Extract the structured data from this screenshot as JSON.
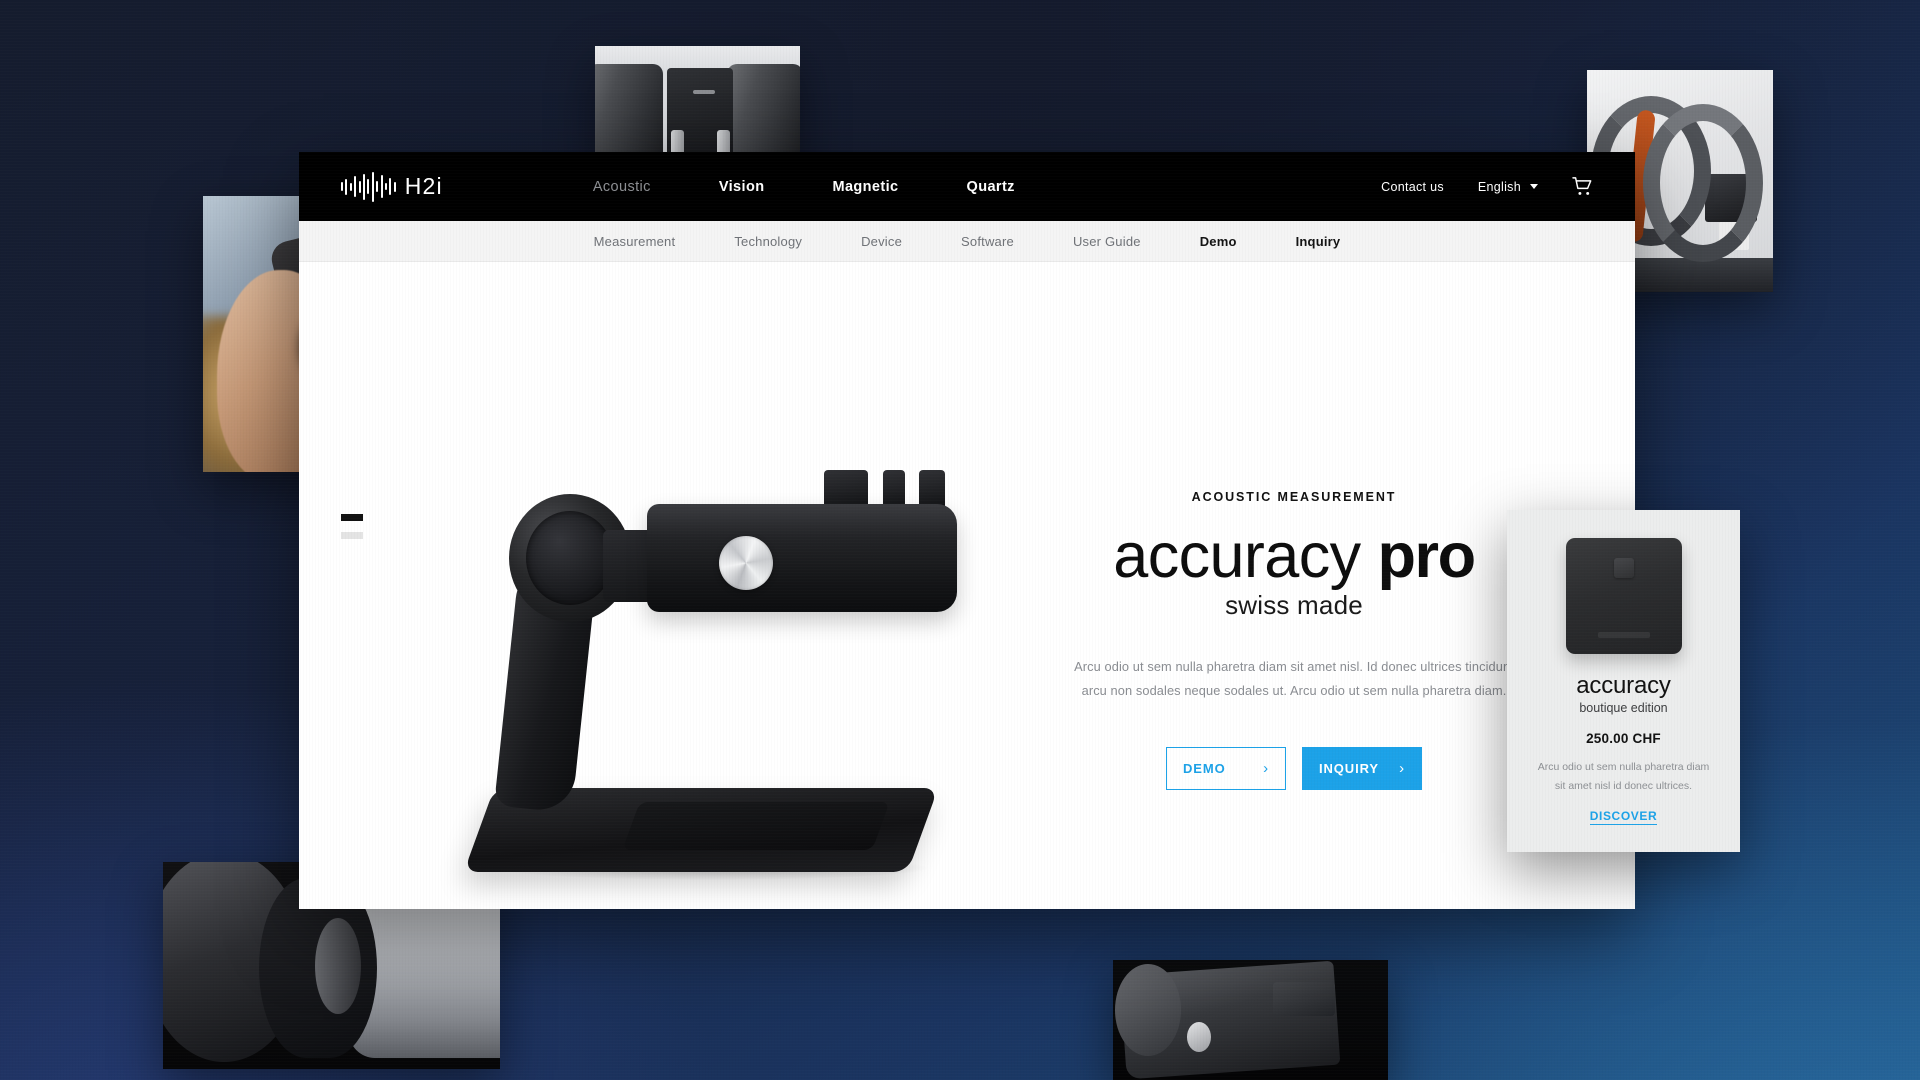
{
  "site": {
    "logo": {
      "text": "H2i",
      "icon": "waveform-icon"
    },
    "main_nav": [
      {
        "label": "Acoustic",
        "state": "muted"
      },
      {
        "label": "Vision",
        "state": "active"
      },
      {
        "label": "Magnetic",
        "state": "active"
      },
      {
        "label": "Quartz",
        "state": "active"
      }
    ],
    "nav_right": {
      "contact_label": "Contact us",
      "language": "English",
      "language_caret_icon": "chevron-down-icon",
      "cart_icon": "shopping-cart-icon"
    },
    "sub_nav": [
      {
        "label": "Measurement",
        "active": false
      },
      {
        "label": "Technology",
        "active": false
      },
      {
        "label": "Device",
        "active": false
      },
      {
        "label": "Software",
        "active": false
      },
      {
        "label": "User Guide",
        "active": false
      },
      {
        "label": "Demo",
        "active": true
      },
      {
        "label": "Inquiry",
        "active": true
      }
    ]
  },
  "hero": {
    "eyebrow": "ACOUSTIC MEASUREMENT",
    "headline_light": "accuracy ",
    "headline_bold": "pro",
    "subhead": "swiss made",
    "blurb_line1": "Arcu odio ut sem nulla pharetra diam sit amet nisl. Id donec ultrices tincidunt",
    "blurb_line2": "arcu non sodales neque sodales ut. Arcu odio ut sem nulla pharetra diam.",
    "cta_demo": "DEMO",
    "cta_inquiry": "INQUIRY",
    "chevron": "›",
    "product_image_alt": "accuracy-pro-device-on-stand"
  },
  "product_card": {
    "device_image_alt": "accuracy-boutique-device",
    "title": "accuracy",
    "subtitle": "boutique edition",
    "price": "250.00 CHF",
    "desc_line1": "Arcu odio ut sem nulla pharetra diam",
    "desc_line2": "sit amet nisl id donec ultrices.",
    "link_label": "DISCOVER"
  },
  "decor_images": [
    {
      "name": "top-center-mechanism-photo"
    },
    {
      "name": "top-right-helmholtz-coil-photo"
    },
    {
      "name": "left-wristwatch-in-hands-photo"
    },
    {
      "name": "bottom-left-metal-cylinder-photo"
    },
    {
      "name": "bottom-center-device-closeup-photo"
    }
  ],
  "colors": {
    "accent": "#1ca2e8",
    "nav_bg": "#000000",
    "subnav_bg": "#f4f4f4",
    "card_bg": "#eceded",
    "backdrop_dark": "#151c2e",
    "backdrop_blue": "#1d5180"
  }
}
